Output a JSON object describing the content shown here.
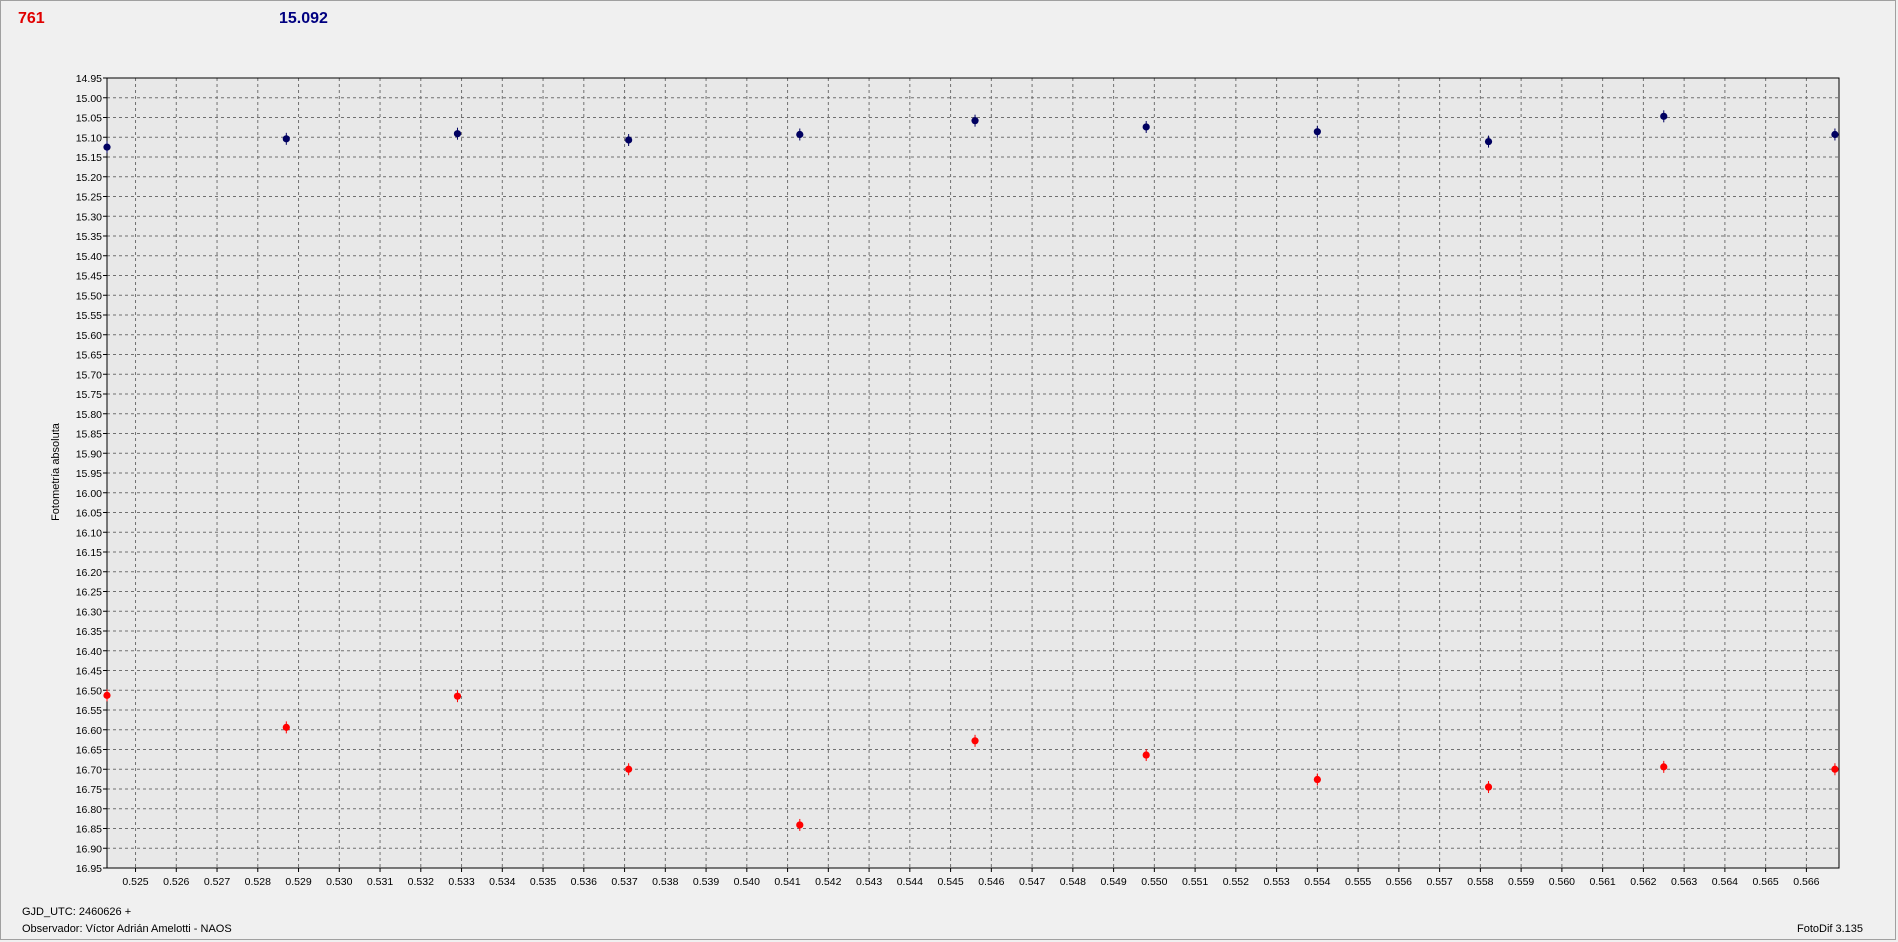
{
  "header": {
    "variable_value": "761",
    "comparison_value": "15.092"
  },
  "footer": {
    "gjd": "GJD_UTC: 2460626 +",
    "observer": "Observador: Víctor Adrián Amelotti - NAOS",
    "software": "FotoDif 3.135"
  },
  "colors": {
    "variable": "#ff0000",
    "comparison": "#000060",
    "plot_bg": "#e8e8e8",
    "grid": "#707070"
  },
  "chart_data": {
    "type": "scatter",
    "title": "",
    "xlabel": "",
    "ylabel": "Fotometría absoluta",
    "xlim": [
      0.5243,
      0.5668
    ],
    "ylim": [
      14.95,
      16.95
    ],
    "y_inverted": true,
    "grid": true,
    "x_ticks": [
      "0.525",
      "0.526",
      "0.527",
      "0.528",
      "0.529",
      "0.530",
      "0.531",
      "0.532",
      "0.533",
      "0.534",
      "0.535",
      "0.536",
      "0.537",
      "0.538",
      "0.539",
      "0.540",
      "0.541",
      "0.542",
      "0.543",
      "0.544",
      "0.545",
      "0.546",
      "0.547",
      "0.548",
      "0.549",
      "0.550",
      "0.551",
      "0.552",
      "0.553",
      "0.554",
      "0.555",
      "0.556",
      "0.557",
      "0.558",
      "0.559",
      "0.560",
      "0.561",
      "0.562",
      "0.563",
      "0.564",
      "0.565",
      "0.566"
    ],
    "y_ticks": [
      "14.95",
      "15.00",
      "15.05",
      "15.10",
      "15.15",
      "15.20",
      "15.25",
      "15.30",
      "15.35",
      "15.40",
      "15.45",
      "15.50",
      "15.55",
      "15.60",
      "15.65",
      "15.70",
      "15.75",
      "15.80",
      "15.85",
      "15.90",
      "15.95",
      "16.00",
      "16.05",
      "16.10",
      "16.15",
      "16.20",
      "16.25",
      "16.30",
      "16.35",
      "16.40",
      "16.45",
      "16.50",
      "16.55",
      "16.60",
      "16.65",
      "16.70",
      "16.75",
      "16.80",
      "16.85",
      "16.90",
      "16.95"
    ],
    "series": [
      {
        "role": "comparison",
        "color": "#000060",
        "x": [
          0.5243,
          0.5287,
          0.5329,
          0.5371,
          0.5413,
          0.5456,
          0.5498,
          0.554,
          0.5582,
          0.5625,
          0.5667
        ],
        "y": [
          15.125,
          15.104,
          15.091,
          15.107,
          15.093,
          15.058,
          15.074,
          15.086,
          15.111,
          15.047,
          15.093
        ]
      },
      {
        "role": "variable",
        "color": "#ff0000",
        "x": [
          0.5243,
          0.5287,
          0.5329,
          0.5371,
          0.5413,
          0.5456,
          0.5498,
          0.554,
          0.5582,
          0.5625,
          0.5667
        ],
        "y": [
          16.513,
          16.594,
          16.515,
          16.7,
          16.841,
          16.628,
          16.664,
          16.726,
          16.745,
          16.694,
          16.7
        ]
      }
    ]
  }
}
